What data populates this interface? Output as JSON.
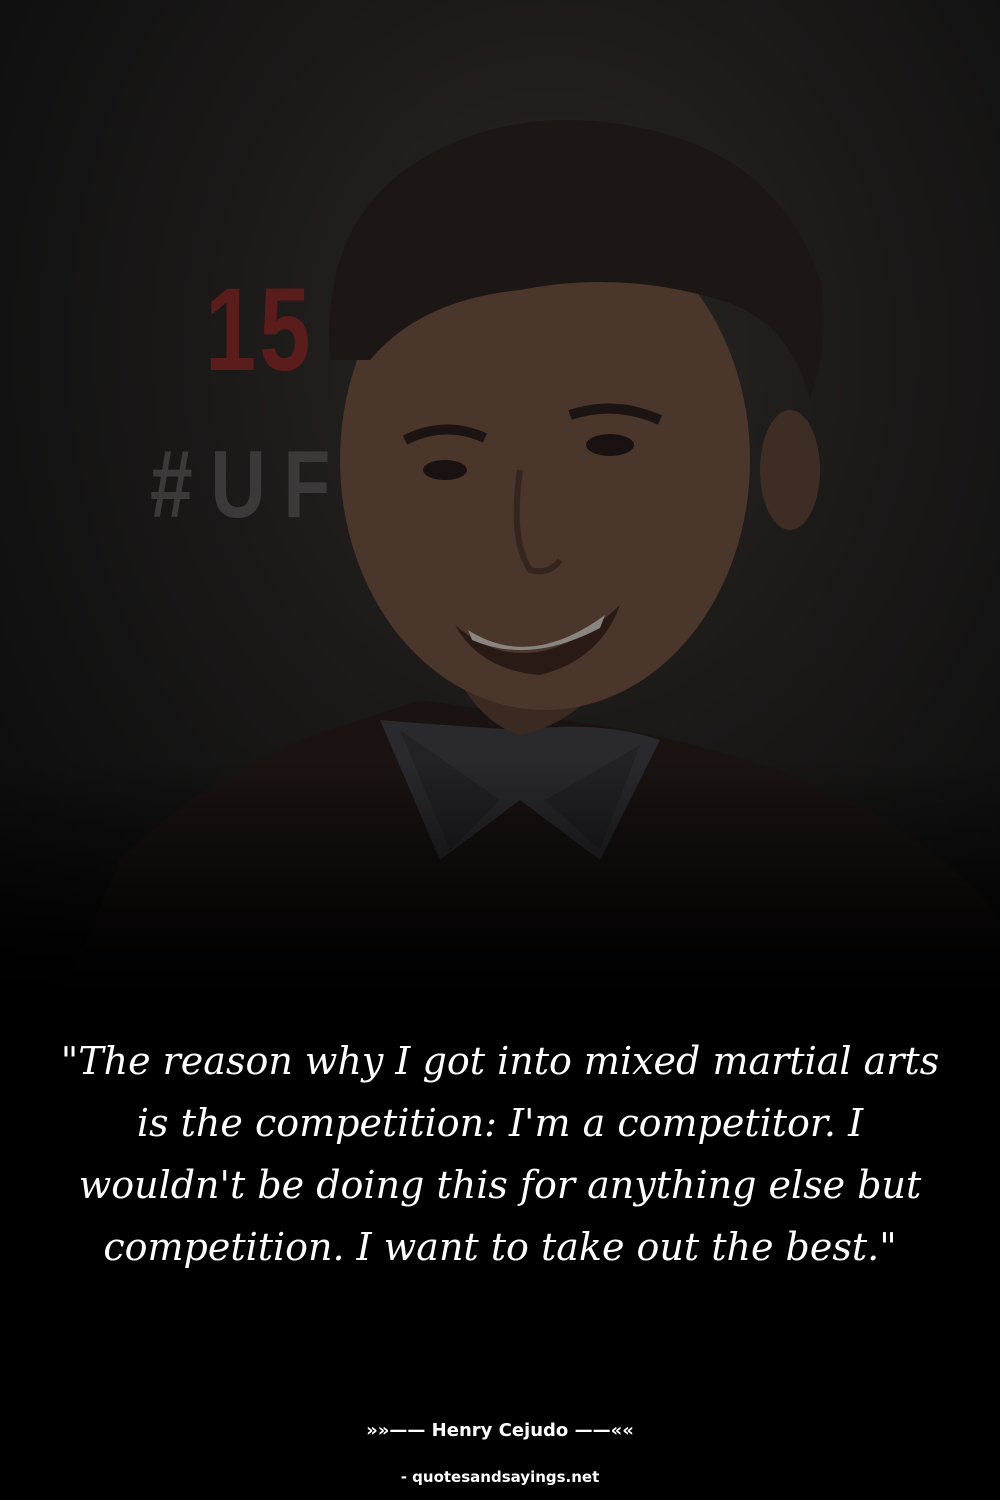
{
  "background": {
    "text_number": "15",
    "text_hashtag": "#UF"
  },
  "quote": {
    "text": "\"The reason why I got into mixed martial arts is the competition: I'm a competitor. I wouldn't be doing this for anything else but competition. I want to take out the best.\""
  },
  "author": {
    "line": "»»—— Henry Cejudo ——««"
  },
  "source": {
    "line": "- quotesandsayings.net"
  },
  "colors": {
    "background": "#000000",
    "text": "#ffffff",
    "accent_red": "#5a1d1b"
  }
}
